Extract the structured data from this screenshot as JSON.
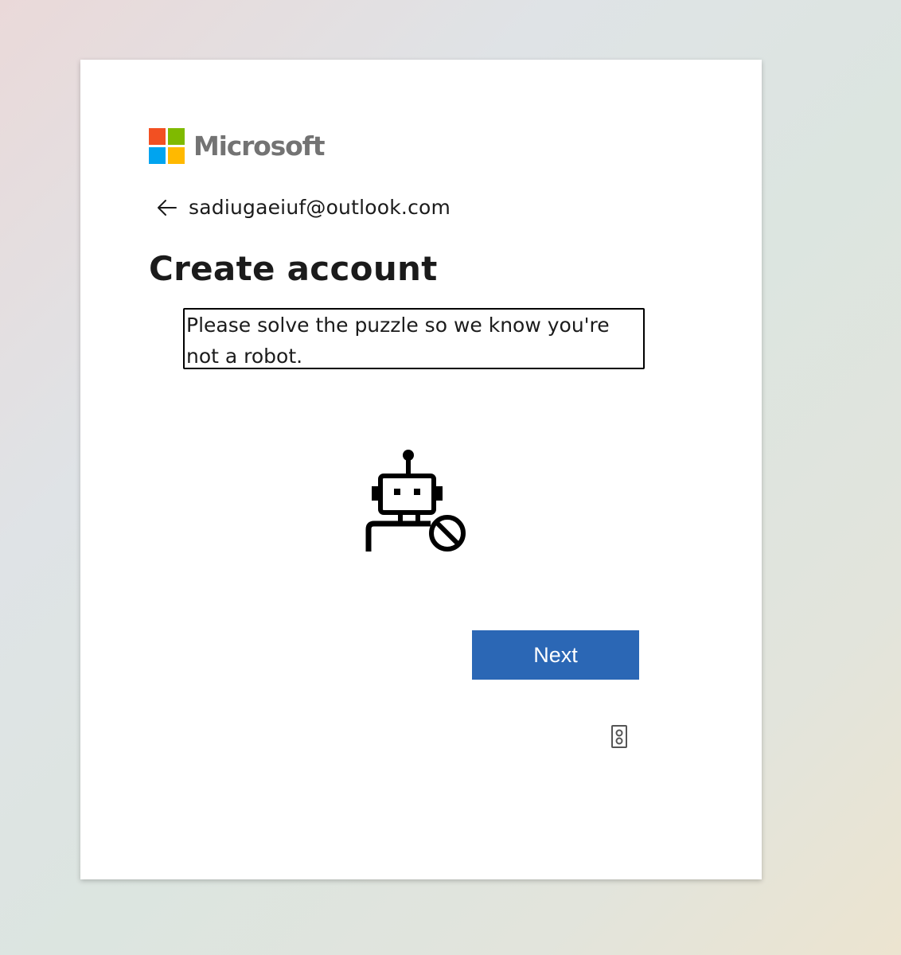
{
  "brand": {
    "name": "Microsoft",
    "logo_colors": [
      "#f25022",
      "#7fba00",
      "#00a4ef",
      "#ffb900"
    ]
  },
  "identity": {
    "back_icon": "arrow-left-icon",
    "email": "sadiugaeiuf@outlook.com"
  },
  "page": {
    "title": "Create account",
    "instruction": "Please solve the puzzle so we know you're not a robot.",
    "illustration_icon": "robot-blocked-icon"
  },
  "actions": {
    "next_label": "Next",
    "audio_icon": "speaker-icon"
  },
  "colors": {
    "primary_button": "#2b67b5",
    "text": "#1b1b1b"
  }
}
